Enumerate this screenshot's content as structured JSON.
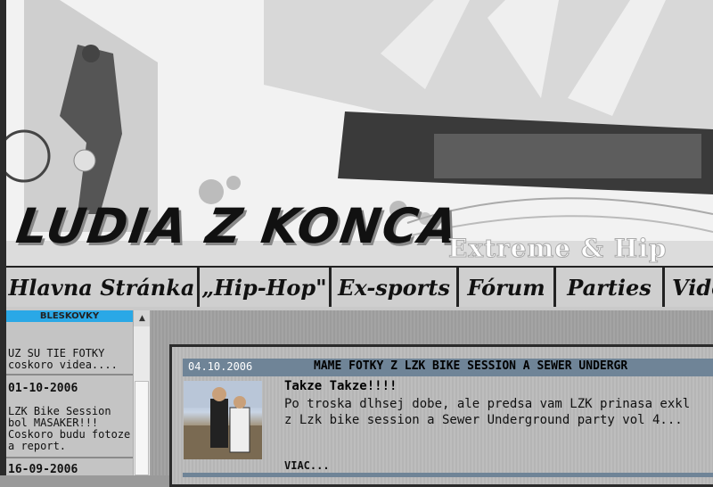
{
  "banner": {
    "logo_text": "LUDIA Z KONCA",
    "tagline": "Extreme & Hip"
  },
  "nav": {
    "items": [
      {
        "label": "Hlavna Stránka"
      },
      {
        "label": "„Hip-Hop\""
      },
      {
        "label": "Ex-sports"
      },
      {
        "label": "Fórum"
      },
      {
        "label": "Parties"
      },
      {
        "label": "Vide"
      }
    ]
  },
  "sidebar": {
    "header": "BLESKOVKY",
    "entries": [
      {
        "date": "",
        "text": "UZ SU TIE FOTKY coskoro videa...."
      },
      {
        "date": "01-10-2006",
        "text": "LZK Bike Session bol MASAKER!!! Coskoro budu fotoze a report."
      },
      {
        "date": "16-09-2006",
        "text": ""
      }
    ]
  },
  "news": {
    "date": "04.10.2006",
    "title": "MAME FOTKY Z LZK BIKE SESSION A SEWER UNDERGR",
    "heading": "Takze Takze!!!!",
    "line1": "Po troska dlhsej dobe, ale predsa vam LZK prinasa exkl",
    "line2": "z Lzk bike session a Sewer Underground party vol 4...",
    "more": "VIAC..."
  }
}
